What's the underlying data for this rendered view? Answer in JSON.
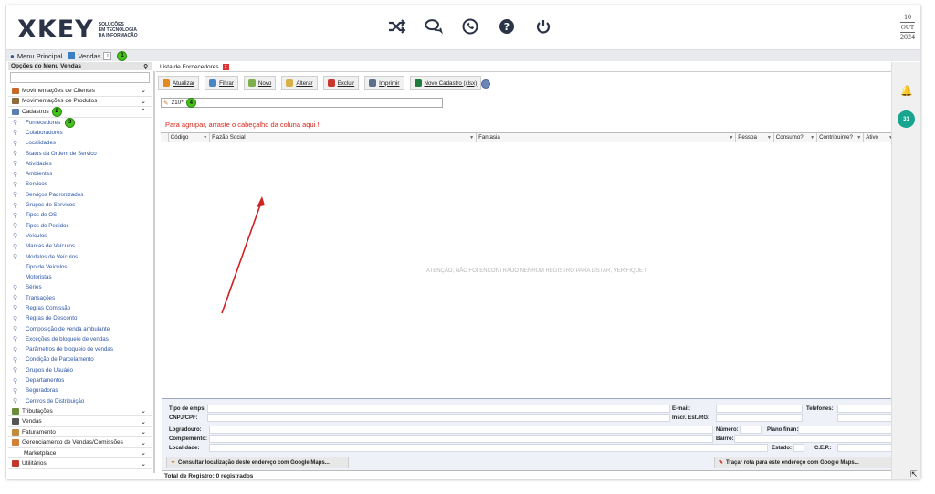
{
  "header": {
    "logo_text": "XKEY",
    "logo_sub": [
      "SOLUÇÕES",
      "EM TECNOLOGIA",
      "DA INFORMAÇÃO"
    ],
    "icons": [
      "shuffle-icon",
      "chat-icon",
      "whatsapp-icon",
      "help-icon",
      "power-icon"
    ],
    "date": {
      "day": "10",
      "month": "OUT",
      "year": "2024"
    }
  },
  "menubar": {
    "menu_principal": "Menu Principal",
    "vendas": "Vendas",
    "badge1": "1"
  },
  "sidebar": {
    "title": "Opções do Menu Vendas",
    "pin": "❐",
    "groups_top": [
      {
        "label": "Movimentações de Clientes",
        "chev": "⌄",
        "color": "#c56a2b"
      },
      {
        "label": "Movimentações de Produtos",
        "chev": "⌄",
        "color": "#8e6b3e"
      },
      {
        "label": "Cadastros",
        "chev": "⌃",
        "color": "#5b7fb3"
      }
    ],
    "badge2": "2",
    "badge3": "3",
    "items": [
      {
        "label": "Fornecedores",
        "icon": true
      },
      {
        "label": "Colaboradores",
        "icon": true
      },
      {
        "label": "Localidades",
        "icon": true
      },
      {
        "label": "Status da Ordem de Servico",
        "icon": true
      },
      {
        "label": "Atividades",
        "icon": true
      },
      {
        "label": "Ambientes",
        "icon": true
      },
      {
        "label": "Servicos",
        "icon": true
      },
      {
        "label": "Serviços Padronizados",
        "icon": true
      },
      {
        "label": "Grupos de Serviços",
        "icon": true
      },
      {
        "label": "Tipos de OS",
        "icon": true
      },
      {
        "label": "Tipos de Pedidos",
        "icon": true
      },
      {
        "label": "Veículos",
        "icon": true
      },
      {
        "label": "Marcas de Veículos",
        "icon": true
      },
      {
        "label": "Modelos de Veículos",
        "icon": true
      },
      {
        "label": "Tipo de Veículos",
        "icon": false
      },
      {
        "label": "Motoristas",
        "icon": false
      },
      {
        "label": "Séries",
        "icon": true
      },
      {
        "label": "Transações",
        "icon": true
      },
      {
        "label": "Regras Comissão",
        "icon": true
      },
      {
        "label": "Regras de Desconto",
        "icon": true
      },
      {
        "label": "Composição de venda ambulante",
        "icon": true
      },
      {
        "label": "Exceções de bloqueio de vendas",
        "icon": true
      },
      {
        "label": "Parâmetros de bloqueio de vendas",
        "icon": true
      },
      {
        "label": "Condição de Parcelamento",
        "icon": true
      },
      {
        "label": "Grupos de Usuário",
        "icon": true
      },
      {
        "label": "Departamentos",
        "icon": true
      },
      {
        "label": "Seguradoras",
        "icon": true
      },
      {
        "label": "Centros de Distribuição",
        "icon": true
      }
    ],
    "groups_bottom": [
      {
        "label": "Tributações",
        "chev": "⌄",
        "color": "#6b8c3a"
      },
      {
        "label": "Vendas",
        "chev": "⌄",
        "color": "#555555"
      },
      {
        "label": "Faturamento",
        "chev": "⌄",
        "color": "#c48a3b"
      },
      {
        "label": "Gerenciamento de Vendas/Comissões",
        "chev": "⌄",
        "color": "#d1803a"
      },
      {
        "label": "Marketplace",
        "chev": "⌄",
        "color": ""
      },
      {
        "label": "Utilitários",
        "chev": "⌄",
        "color": "#c0392b"
      }
    ]
  },
  "tab": {
    "label": "Lista de Fornecedores",
    "close": "x"
  },
  "toolbar": [
    {
      "label": "Atualizar",
      "color": "#e38a1f"
    },
    {
      "label": "Filtrar",
      "color": "#4a86c5"
    },
    {
      "label": "Novo",
      "color": "#7db04a"
    },
    {
      "label": "Alterar",
      "color": "#d7b04a"
    },
    {
      "label": "Excluir",
      "color": "#c8372d"
    },
    {
      "label": "Imprimir",
      "color": "#5c6f8c"
    },
    {
      "label": "Novo Cadastro (xlsx)",
      "color": "#1f7a3d"
    }
  ],
  "filter": {
    "value": "210*",
    "badge4": "4"
  },
  "grid": {
    "group_hint": "Para agrupar, arraste o cabeçalho da coluna aqui !",
    "columns": [
      "Código",
      "Razão Social",
      "Fantasia",
      "Pessoa",
      "Consumo?",
      "Contribuinte?",
      "Ativo"
    ],
    "empty_message": "ATENÇÃO, NÃO FOI ENCONTRADO NENHUM REGISTRO PARA LISTAR, VERIFIQUE !"
  },
  "details": {
    "tipo_emp": "Tipo de emps:",
    "cnpj": "CNPJ/CPF:",
    "logradouro": "Logradouro:",
    "complemento": "Complemento:",
    "localidade": "Localidade:",
    "email": "E-mail:",
    "inscr": "Inscr. Est./RG:",
    "telefones": "Telefones:",
    "numero": "Número:",
    "plano": "Plano finan:",
    "bairro": "Bairro:",
    "estado": "Estado:",
    "cep": "C.E.P.:",
    "map_btn1": "Consultar localização deste endereço com Google Maps...",
    "map_btn2": "Traçar rota para este endereço com Google Maps..."
  },
  "status": "Total de Registro: 0 registrados",
  "rail": {
    "cal_label": "31"
  }
}
